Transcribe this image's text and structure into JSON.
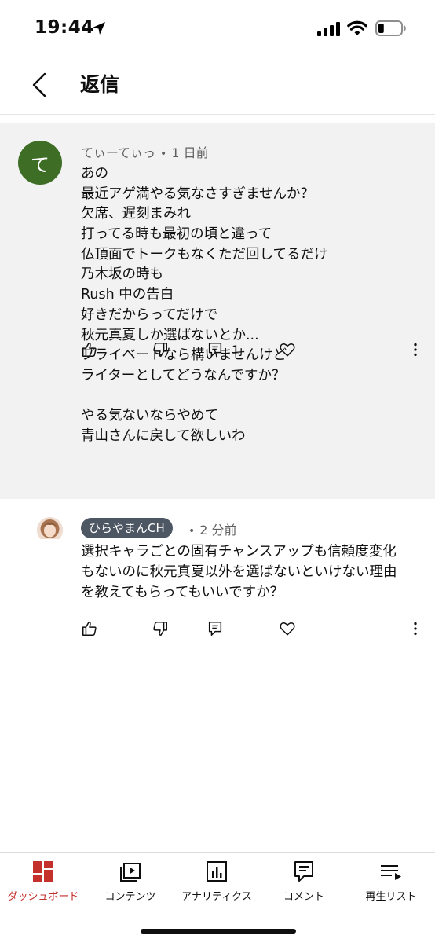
{
  "status_bar": {
    "time": "19:44",
    "icons": [
      "location-arrow-icon",
      "cellular-signal-icon",
      "wifi-icon",
      "battery-icon"
    ],
    "battery_level": 0.25
  },
  "header": {
    "back_icon": "chevron-left-icon",
    "title": "返信"
  },
  "comments": [
    {
      "author": "てぃーてぃっ",
      "avatar_letter": "て",
      "avatar_color": "#3e6e26",
      "time": "1 日前",
      "highlighted": true,
      "lines": [
        "あの",
        "最近アゲ満やる気なさすぎませんか？",
        "欠席、遅刻まみれ",
        "打ってる時も最初の頃と違って",
        "仏頂面でトークもなくただ回してるだけ",
        "乃木坂の時も",
        "Rush 中の告白",
        "好きだからってだけで",
        "秋元真夏しか選ばないとか...",
        "プライベートなら構いませんけど",
        "ライターとしてどうなんですか？",
        "",
        "やる気ないならやめて",
        "青山さんに戻して欲しいわ"
      ],
      "reply_count": "1"
    },
    {
      "author": "ひらやまんCH",
      "author_chip_color": "#4d5663",
      "time": "2 分前",
      "highlighted": false,
      "lines": [
        "選択キャラごとの固有チャンスアップも信頼度変化",
        "もないのに秋元真夏以外を選ばないといけない理由",
        "を教えてもらってもいいですか？"
      ]
    }
  ],
  "actions": {
    "icons": [
      "thumbs-up-icon",
      "thumbs-down-icon",
      "reply-icon",
      "heart-icon",
      "more-vertical-icon"
    ]
  },
  "bottom_nav": {
    "accent": "#c4302b",
    "items": [
      {
        "label": "ダッシュボード",
        "icon": "dashboard-icon",
        "active": true
      },
      {
        "label": "コンテンツ",
        "icon": "content-icon",
        "active": false
      },
      {
        "label": "アナリティクス",
        "icon": "analytics-icon",
        "active": false
      },
      {
        "label": "コメント",
        "icon": "comment-icon",
        "active": false
      },
      {
        "label": "再生リスト",
        "icon": "playlist-icon",
        "active": false
      }
    ]
  }
}
